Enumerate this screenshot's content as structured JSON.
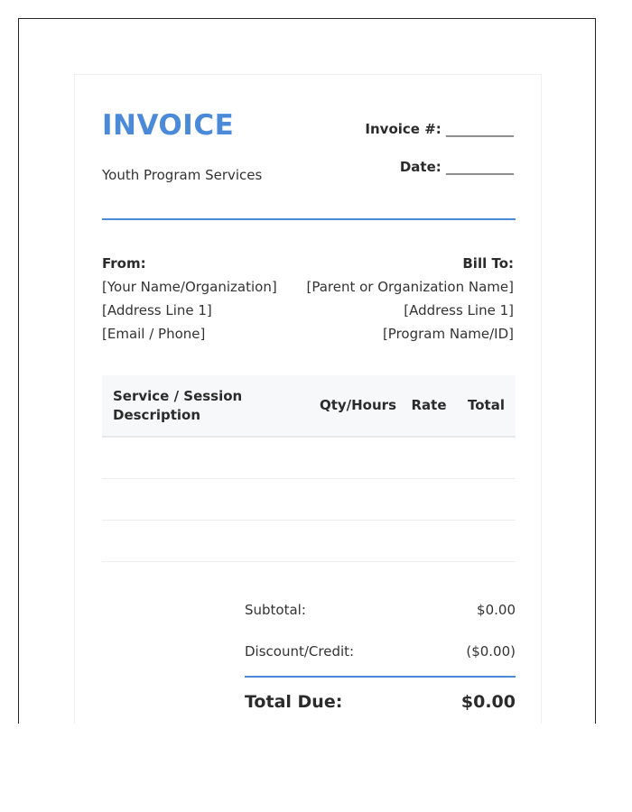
{
  "header": {
    "title": "INVOICE",
    "subtitle": "Youth Program Services",
    "invoice_label": "Invoice #:",
    "invoice_blank": "__________",
    "date_label": "Date:",
    "date_blank": "__________"
  },
  "from": {
    "label": "From:",
    "lines": [
      "[Your Name/Organization]",
      "[Address Line 1]",
      "[Email / Phone]"
    ]
  },
  "bill_to": {
    "label": "Bill To:",
    "lines": [
      "[Parent or Organization Name]",
      "[Address Line 1]",
      "[Program Name/ID]"
    ]
  },
  "table": {
    "columns": [
      "Service / Session Description",
      "Qty/Hours",
      "Rate",
      "Total"
    ],
    "rows": [
      [
        "",
        "",
        "",
        ""
      ],
      [
        "",
        "",
        "",
        ""
      ],
      [
        "",
        "",
        "",
        ""
      ]
    ]
  },
  "totals": {
    "subtotal_label": "Subtotal:",
    "subtotal_value": "$0.00",
    "discount_label": "Discount/Credit:",
    "discount_value": "($0.00)",
    "due_label": "Total Due:",
    "due_value": "$0.00"
  },
  "colors": {
    "accent": "#4a8ad8"
  }
}
